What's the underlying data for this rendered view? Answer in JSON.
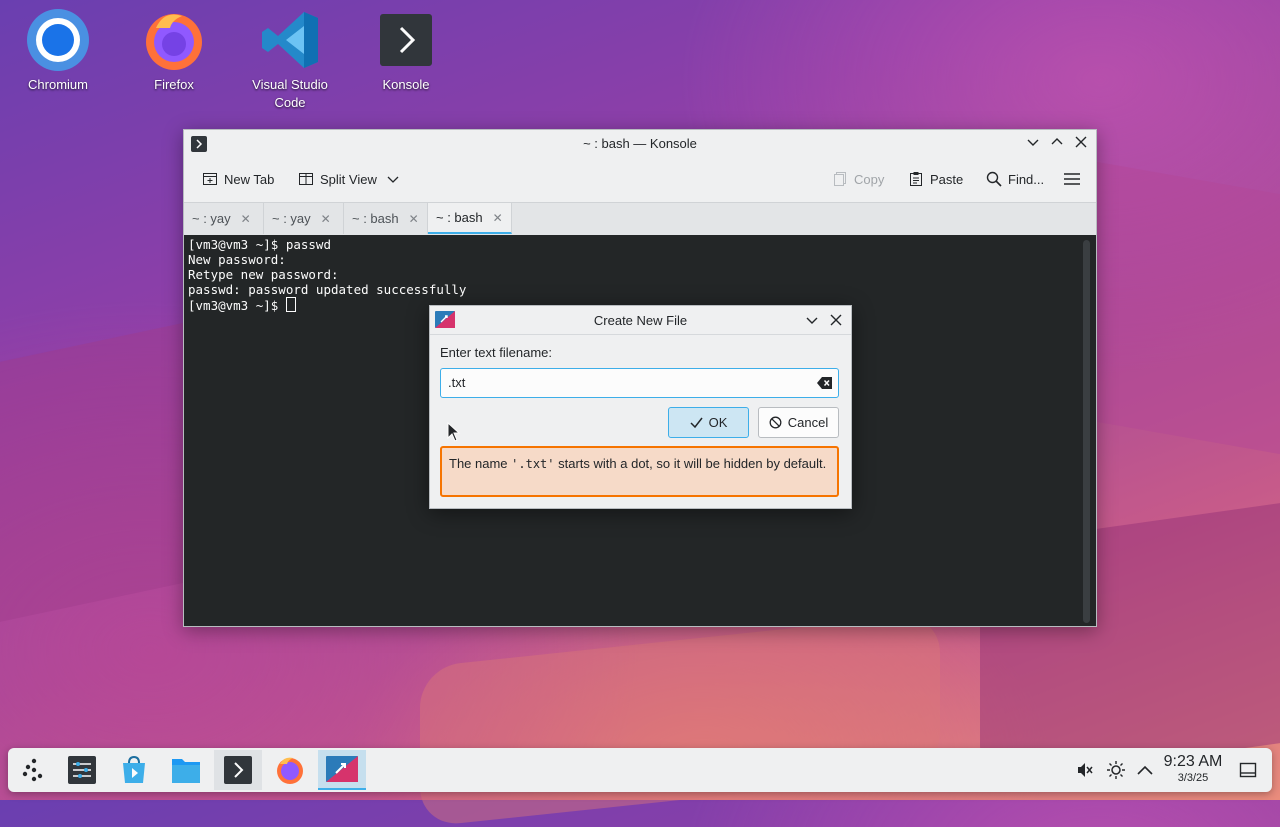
{
  "desktop": {
    "icons": [
      {
        "label": "Chromium",
        "icon": "chromium-icon"
      },
      {
        "label": "Firefox",
        "icon": "firefox-icon"
      },
      {
        "label_line1": "Visual Studio",
        "label_line2": "Code",
        "icon": "vscode-icon"
      },
      {
        "label": "Konsole",
        "icon": "konsole-icon"
      }
    ]
  },
  "konsole": {
    "title": "~ : bash — Konsole",
    "toolbar": {
      "new_tab": "New Tab",
      "split_view": "Split View",
      "copy": "Copy",
      "paste": "Paste",
      "find": "Find..."
    },
    "tabs": [
      {
        "label": "~ : yay"
      },
      {
        "label": "~ : yay"
      },
      {
        "label": "~ : bash"
      },
      {
        "label": "~ : bash"
      }
    ],
    "terminal_lines": [
      "[vm3@vm3 ~]$ passwd",
      "New password:",
      "Retype new password:",
      "passwd: password updated successfully",
      "[vm3@vm3 ~]$ "
    ]
  },
  "dialog": {
    "title": "Create New File",
    "label": "Enter text filename:",
    "input_value": ".txt",
    "ok": "OK",
    "cancel": "Cancel",
    "warning_pre": "The name ",
    "warning_code": "'.txt'",
    "warning_post": " starts with a dot, so it will be hidden by default."
  },
  "panel": {
    "time": "9:23 AM",
    "date": "3/3/25"
  },
  "colors": {
    "accent": "#3daee9",
    "warning_border": "#f67400",
    "warning_bg": "#f6dac8",
    "terminal_bg": "#232627"
  }
}
